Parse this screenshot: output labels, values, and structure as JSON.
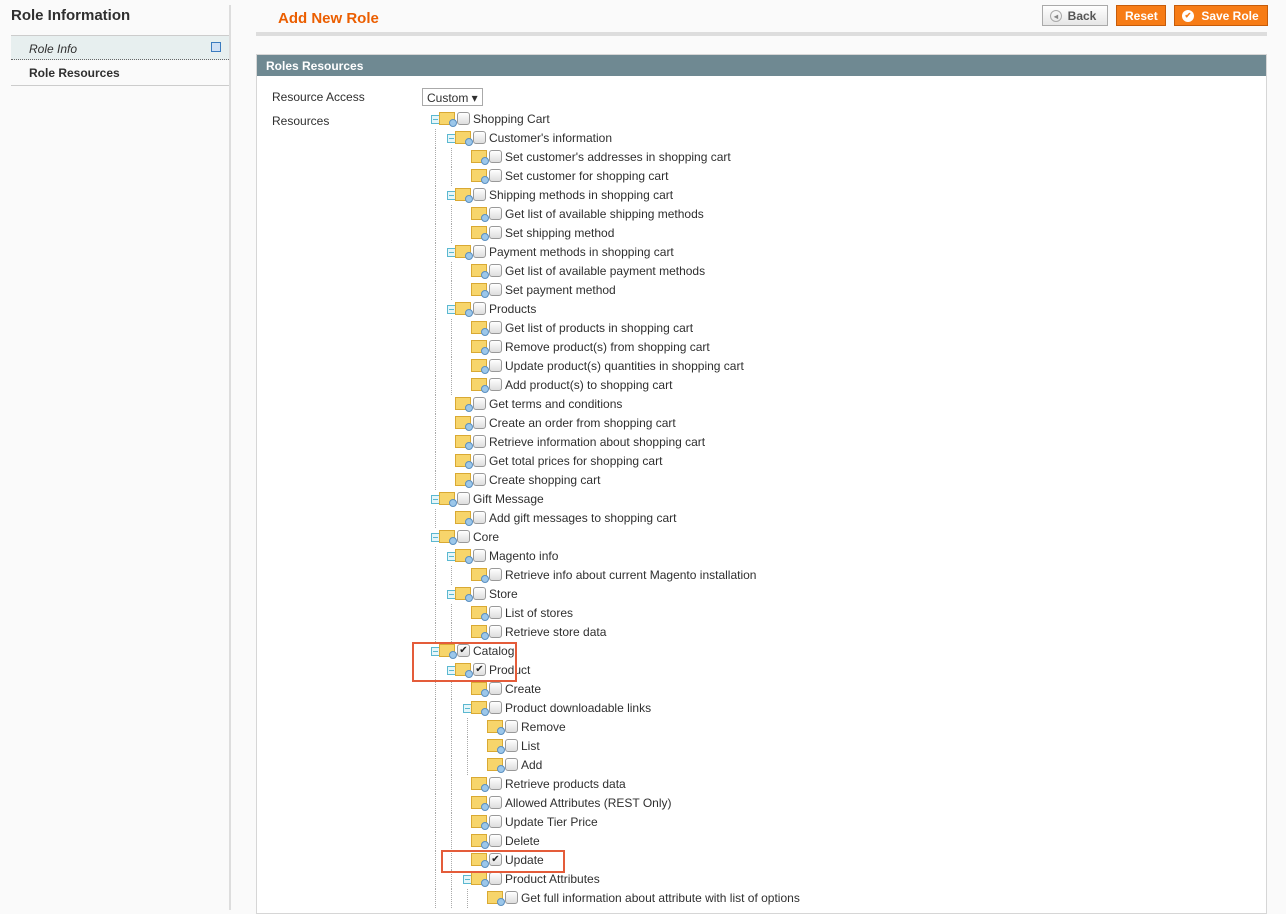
{
  "sidebar": {
    "title": "Role Information",
    "tabs": [
      {
        "label": "Role Info"
      },
      {
        "label": "Role Resources"
      }
    ]
  },
  "header": {
    "title": "Add New Role",
    "back": "Back",
    "reset": "Reset",
    "save": "Save Role"
  },
  "panel": {
    "title": "Roles Resources",
    "resource_access_label": "Resource Access",
    "resource_access_value": "Custom",
    "resources_label": "Resources"
  },
  "highlight_color": "#e45c3a",
  "tree": [
    {
      "l": 0,
      "t": "Shopping Cart",
      "e": 1
    },
    {
      "l": 1,
      "t": "Customer's information",
      "e": 1
    },
    {
      "l": 2,
      "t": "Set customer's addresses in shopping cart"
    },
    {
      "l": 2,
      "t": "Set customer for shopping cart"
    },
    {
      "l": 1,
      "t": "Shipping methods in shopping cart",
      "e": 1
    },
    {
      "l": 2,
      "t": "Get list of available shipping methods"
    },
    {
      "l": 2,
      "t": "Set shipping method"
    },
    {
      "l": 1,
      "t": "Payment methods in shopping cart",
      "e": 1
    },
    {
      "l": 2,
      "t": "Get list of available payment methods"
    },
    {
      "l": 2,
      "t": "Set payment method"
    },
    {
      "l": 1,
      "t": "Products",
      "e": 1
    },
    {
      "l": 2,
      "t": "Get list of products in shopping cart"
    },
    {
      "l": 2,
      "t": "Remove product(s) from shopping cart"
    },
    {
      "l": 2,
      "t": "Update product(s) quantities in shopping cart"
    },
    {
      "l": 2,
      "t": "Add product(s) to shopping cart"
    },
    {
      "l": 1,
      "t": "Get terms and conditions"
    },
    {
      "l": 1,
      "t": "Create an order from shopping cart"
    },
    {
      "l": 1,
      "t": "Retrieve information about shopping cart"
    },
    {
      "l": 1,
      "t": "Get total prices for shopping cart"
    },
    {
      "l": 1,
      "t": "Create shopping cart"
    },
    {
      "l": 0,
      "t": "Gift Message",
      "e": 1
    },
    {
      "l": 1,
      "t": "Add gift messages to shopping cart"
    },
    {
      "l": 0,
      "t": "Core",
      "e": 1
    },
    {
      "l": 1,
      "t": "Magento info",
      "e": 1
    },
    {
      "l": 2,
      "t": "Retrieve info about current Magento installation"
    },
    {
      "l": 1,
      "t": "Store",
      "e": 1
    },
    {
      "l": 2,
      "t": "List of stores"
    },
    {
      "l": 2,
      "t": "Retrieve store data"
    },
    {
      "l": 0,
      "t": "Catalog",
      "e": 1,
      "c": 1
    },
    {
      "l": 1,
      "t": "Product",
      "e": 1,
      "c": 1
    },
    {
      "l": 2,
      "t": "Create"
    },
    {
      "l": 2,
      "t": "Product downloadable links",
      "e": 1
    },
    {
      "l": 3,
      "t": "Remove"
    },
    {
      "l": 3,
      "t": "List"
    },
    {
      "l": 3,
      "t": "Add"
    },
    {
      "l": 2,
      "t": "Retrieve products data"
    },
    {
      "l": 2,
      "t": "Allowed Attributes (REST Only)"
    },
    {
      "l": 2,
      "t": "Update Tier Price"
    },
    {
      "l": 2,
      "t": "Delete"
    },
    {
      "l": 2,
      "t": "Update",
      "c": 1
    },
    {
      "l": 2,
      "t": "Product Attributes",
      "e": 1
    },
    {
      "l": 3,
      "t": "Get full information about attribute with list of options"
    }
  ]
}
